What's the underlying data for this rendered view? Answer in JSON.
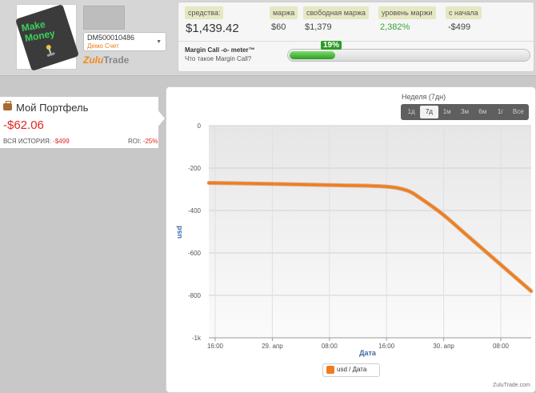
{
  "header": {
    "logo_line1": "Make",
    "logo_line2": "Money",
    "account_id": "DM500010486",
    "account_type": "Демо Счет",
    "brand_part1": "Zulu",
    "brand_part2": "Trade"
  },
  "stats": {
    "funds_label": "средства:",
    "funds_value": "$1,439.42",
    "margin_label": "маржа",
    "margin_value": "$60",
    "free_margin_label": "свободная маржа",
    "free_margin_value": "$1,379",
    "margin_level_label": "уровень маржи",
    "margin_level_value": "2,382%",
    "since_label": "с начала",
    "since_value": "-$499"
  },
  "margin_call": {
    "title": "Margin Call -o- meter™",
    "link": "Что такое Margin Call?",
    "percent": "19%",
    "percent_value": 19
  },
  "portfolio": {
    "title": "Мой Портфель",
    "value": "-$62.06",
    "history_label": "ВСЯ ИСТОРИЯ:",
    "history_value": "-$499",
    "roi_label": "ROI:",
    "roi_value": "-25%"
  },
  "period": {
    "label": "Неделя (7дн)",
    "buttons": [
      "1д",
      "7д",
      "1м",
      "3м",
      "6м",
      "1г",
      "Все"
    ],
    "active": "7д"
  },
  "chart_data": {
    "type": "line",
    "xlabel": "Дата",
    "ylabel": "usd",
    "ylim": [
      -1000,
      0
    ],
    "y_ticks": [
      "0",
      "-200",
      "-400",
      "-600",
      "-800",
      "-1k"
    ],
    "x_ticks": [
      "16:00",
      "29. апр",
      "08:00",
      "16:00",
      "30. апр",
      "08:00"
    ],
    "x_range_hours": [
      0,
      44
    ],
    "grid": true,
    "legend": "bottom-center",
    "series": [
      {
        "name": "usd / Дата",
        "color": "#f07d1c",
        "x": [
          0,
          6,
          12,
          18,
          24,
          27,
          29,
          32,
          35,
          38,
          41,
          44
        ],
        "y": [
          -270,
          -273,
          -277,
          -281,
          -287,
          -305,
          -345,
          -420,
          -510,
          -600,
          -690,
          -780
        ]
      }
    ]
  },
  "legend_label": "usd / Дата",
  "credit": "ZuluTrade.com"
}
